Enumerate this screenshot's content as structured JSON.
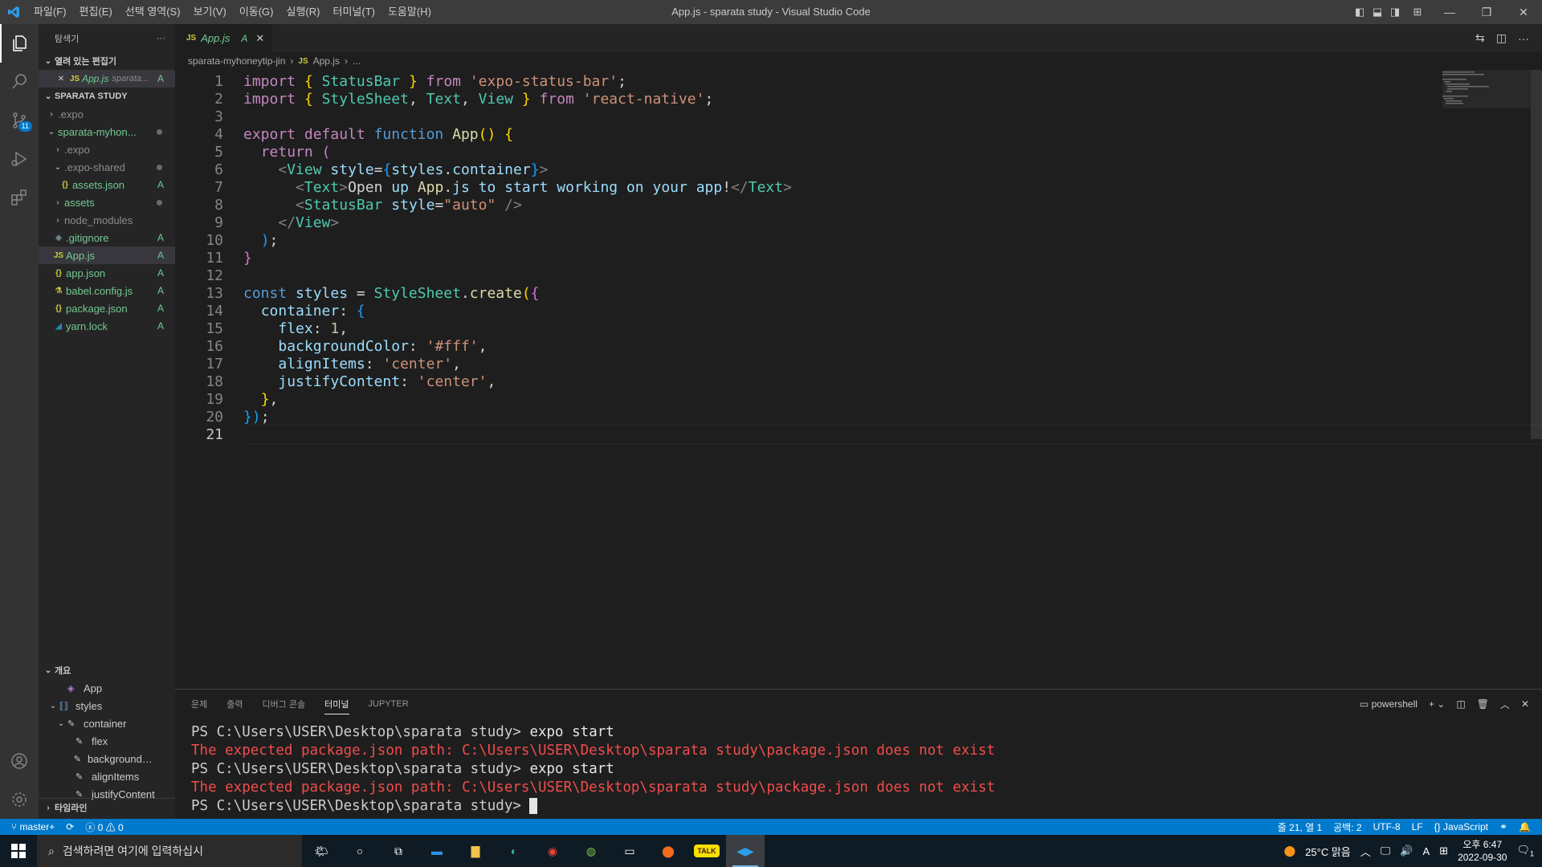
{
  "window": {
    "title": "App.js - sparata study - Visual Studio Code"
  },
  "menu": [
    "파일(F)",
    "편집(E)",
    "선택 영역(S)",
    "보기(V)",
    "이동(G)",
    "실행(R)",
    "터미널(T)",
    "도움말(H)"
  ],
  "activity": {
    "scm_badge": "11"
  },
  "sidebar": {
    "title": "탐색기",
    "more": "···",
    "open_editors": "열려 있는 편집기",
    "open_file": {
      "name": "App.js",
      "path": "sparata...",
      "status": "A"
    },
    "project": "SPARATA STUDY",
    "tree": [
      {
        "label": ".expo",
        "indent": 0,
        "chev": "›",
        "status": ""
      },
      {
        "label": "sparata-myhon...",
        "indent": 0,
        "chev": "⌄",
        "status": "dot"
      },
      {
        "label": ".expo",
        "indent": 1,
        "chev": "›",
        "status": ""
      },
      {
        "label": ".expo-shared",
        "indent": 1,
        "chev": "⌄",
        "status": "dot"
      },
      {
        "label": "assets.json",
        "indent": 2,
        "icon": "{}",
        "status": "A"
      },
      {
        "label": "assets",
        "indent": 1,
        "chev": "›",
        "status": "dot"
      },
      {
        "label": "node_modules",
        "indent": 1,
        "chev": "›",
        "status": ""
      },
      {
        "label": ".gitignore",
        "indent": 1,
        "icon": "◆",
        "status": "A"
      },
      {
        "label": "App.js",
        "indent": 1,
        "icon": "JS",
        "status": "A"
      },
      {
        "label": "app.json",
        "indent": 1,
        "icon": "{}",
        "status": "A"
      },
      {
        "label": "babel.config.js",
        "indent": 1,
        "icon": "⚗",
        "status": "A"
      },
      {
        "label": "package.json",
        "indent": 1,
        "icon": "{}",
        "status": "A"
      },
      {
        "label": "yarn.lock",
        "indent": 1,
        "icon": "◢",
        "status": "A"
      }
    ],
    "outline_title": "개요",
    "outline": [
      {
        "label": "App",
        "indent": 1,
        "icon": "◈"
      },
      {
        "label": "styles",
        "indent": 0,
        "icon": "[o]"
      },
      {
        "label": "container",
        "indent": 1,
        "icon": "🔧"
      },
      {
        "label": "flex",
        "indent": 2,
        "icon": "🔧"
      },
      {
        "label": "backgroundColor",
        "indent": 2,
        "icon": "🔧"
      },
      {
        "label": "alignItems",
        "indent": 2,
        "icon": "🔧"
      },
      {
        "label": "justifyContent",
        "indent": 2,
        "icon": "🔧"
      }
    ],
    "timeline_title": "타임라인"
  },
  "editor": {
    "tab": {
      "label": "App.js",
      "status": "A",
      "icon": "JS"
    },
    "breadcrumb": [
      "sparata-myhoneytip-jin",
      "App.js",
      "..."
    ],
    "current_line": 21,
    "lines": [
      "import { StatusBar } from 'expo-status-bar';",
      "import { StyleSheet, Text, View } from 'react-native';",
      "",
      "export default function App() {",
      "  return (",
      "    <View style={styles.container}>",
      "      <Text>Open up App.js to start working on your app!</Text>",
      "      <StatusBar style=\"auto\" />",
      "    </View>",
      "  );",
      "}",
      "",
      "const styles = StyleSheet.create({",
      "  container: {",
      "    flex: 1,",
      "    backgroundColor: '#fff',",
      "    alignItems: 'center',",
      "    justifyContent: 'center',",
      "  },",
      "});",
      ""
    ]
  },
  "panel": {
    "tabs": [
      "문제",
      "출력",
      "디버그 콘솔",
      "터미널",
      "JUPYTER"
    ],
    "active_tab": "터미널",
    "shell": "powershell",
    "terminal": [
      {
        "type": "cmd",
        "prompt": "PS C:\\Users\\USER\\Desktop\\sparata study> ",
        "text": "expo start"
      },
      {
        "type": "err",
        "text": "The expected package.json path: C:\\Users\\USER\\Desktop\\sparata study\\package.json does not exist"
      },
      {
        "type": "cmd",
        "prompt": "PS C:\\Users\\USER\\Desktop\\sparata study> ",
        "text": "expo start"
      },
      {
        "type": "err",
        "text": "The expected package.json path: C:\\Users\\USER\\Desktop\\sparata study\\package.json does not exist"
      },
      {
        "type": "cur",
        "prompt": "PS C:\\Users\\USER\\Desktop\\sparata study> ",
        "text": ""
      }
    ]
  },
  "status": {
    "branch": "master+",
    "errors": "0",
    "warnings": "0",
    "position": "줄 21, 열 1",
    "spaces": "공백: 2",
    "encoding": "UTF-8",
    "eol": "LF",
    "language": "JavaScript"
  },
  "taskbar": {
    "search_placeholder": "검색하려면 여기에 입력하십시",
    "weather": "25°C  맑음",
    "ime": "A",
    "time": "오후 6:47",
    "date": "2022-09-30",
    "notifications": "1"
  },
  "colors": {
    "accent": "#007acc",
    "added": "#73c991",
    "error": "#f14c4c"
  }
}
